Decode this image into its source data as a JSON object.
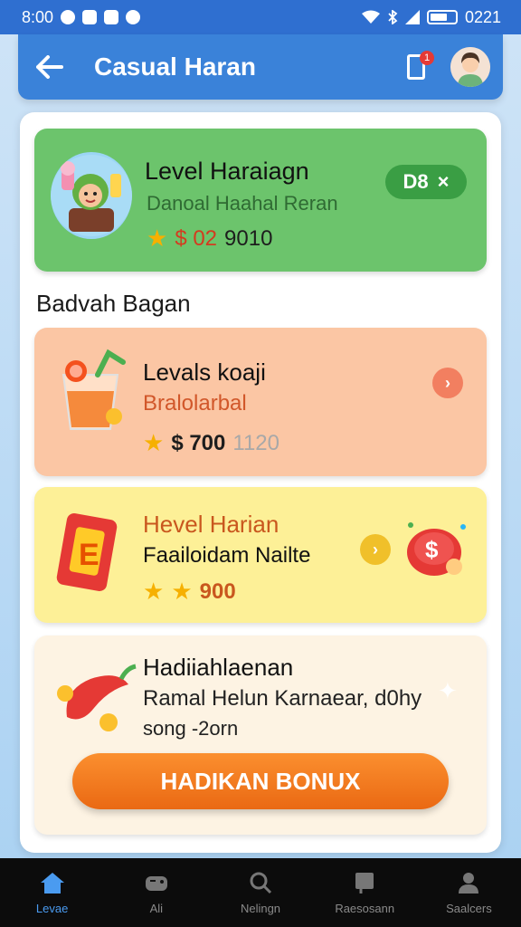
{
  "status_bar": {
    "time": "8:00",
    "right_text": "0221"
  },
  "app_bar": {
    "title": "Casual Haran",
    "notification_count": "1"
  },
  "level_card": {
    "title": "Level Haraiagn",
    "subtitle": "Danoal Haahal Reran",
    "price": "$ 02",
    "points": "9010",
    "badge_label": "D8",
    "badge_close": "×"
  },
  "section_title": "Badvah Bagan",
  "tasks": [
    {
      "title": "Levals koaji",
      "subtitle": "Bralolarbal",
      "price": "$ 700",
      "extra": "1120"
    },
    {
      "title": "Hevel Harian",
      "subtitle": "Faailoidam Nailte",
      "points": "900"
    },
    {
      "title": "Hadiiahlaenan",
      "subtitle": "Ramal Helun Karnaear, d0hy",
      "subtitle2": "song -2orn",
      "button": "HADIKAN BONUX"
    }
  ],
  "bottom_nav": [
    {
      "label": "Levae",
      "icon": "home-icon",
      "active": true
    },
    {
      "label": "Ali",
      "icon": "gamepad-icon",
      "active": false
    },
    {
      "label": "Nelingn",
      "icon": "search-icon",
      "active": false
    },
    {
      "label": "Raesosann",
      "icon": "music-icon",
      "active": false
    },
    {
      "label": "Saalcers",
      "icon": "person-icon",
      "active": false
    }
  ],
  "colors": {
    "primary": "#3a82d9",
    "level_card": "#6cc46c",
    "task_orange": "#fbc6a4",
    "task_yellow": "#fdf097",
    "task_cream": "#fdf3e3",
    "bonus_button": "#f27a1f",
    "nav_active": "#4a9bf0"
  }
}
